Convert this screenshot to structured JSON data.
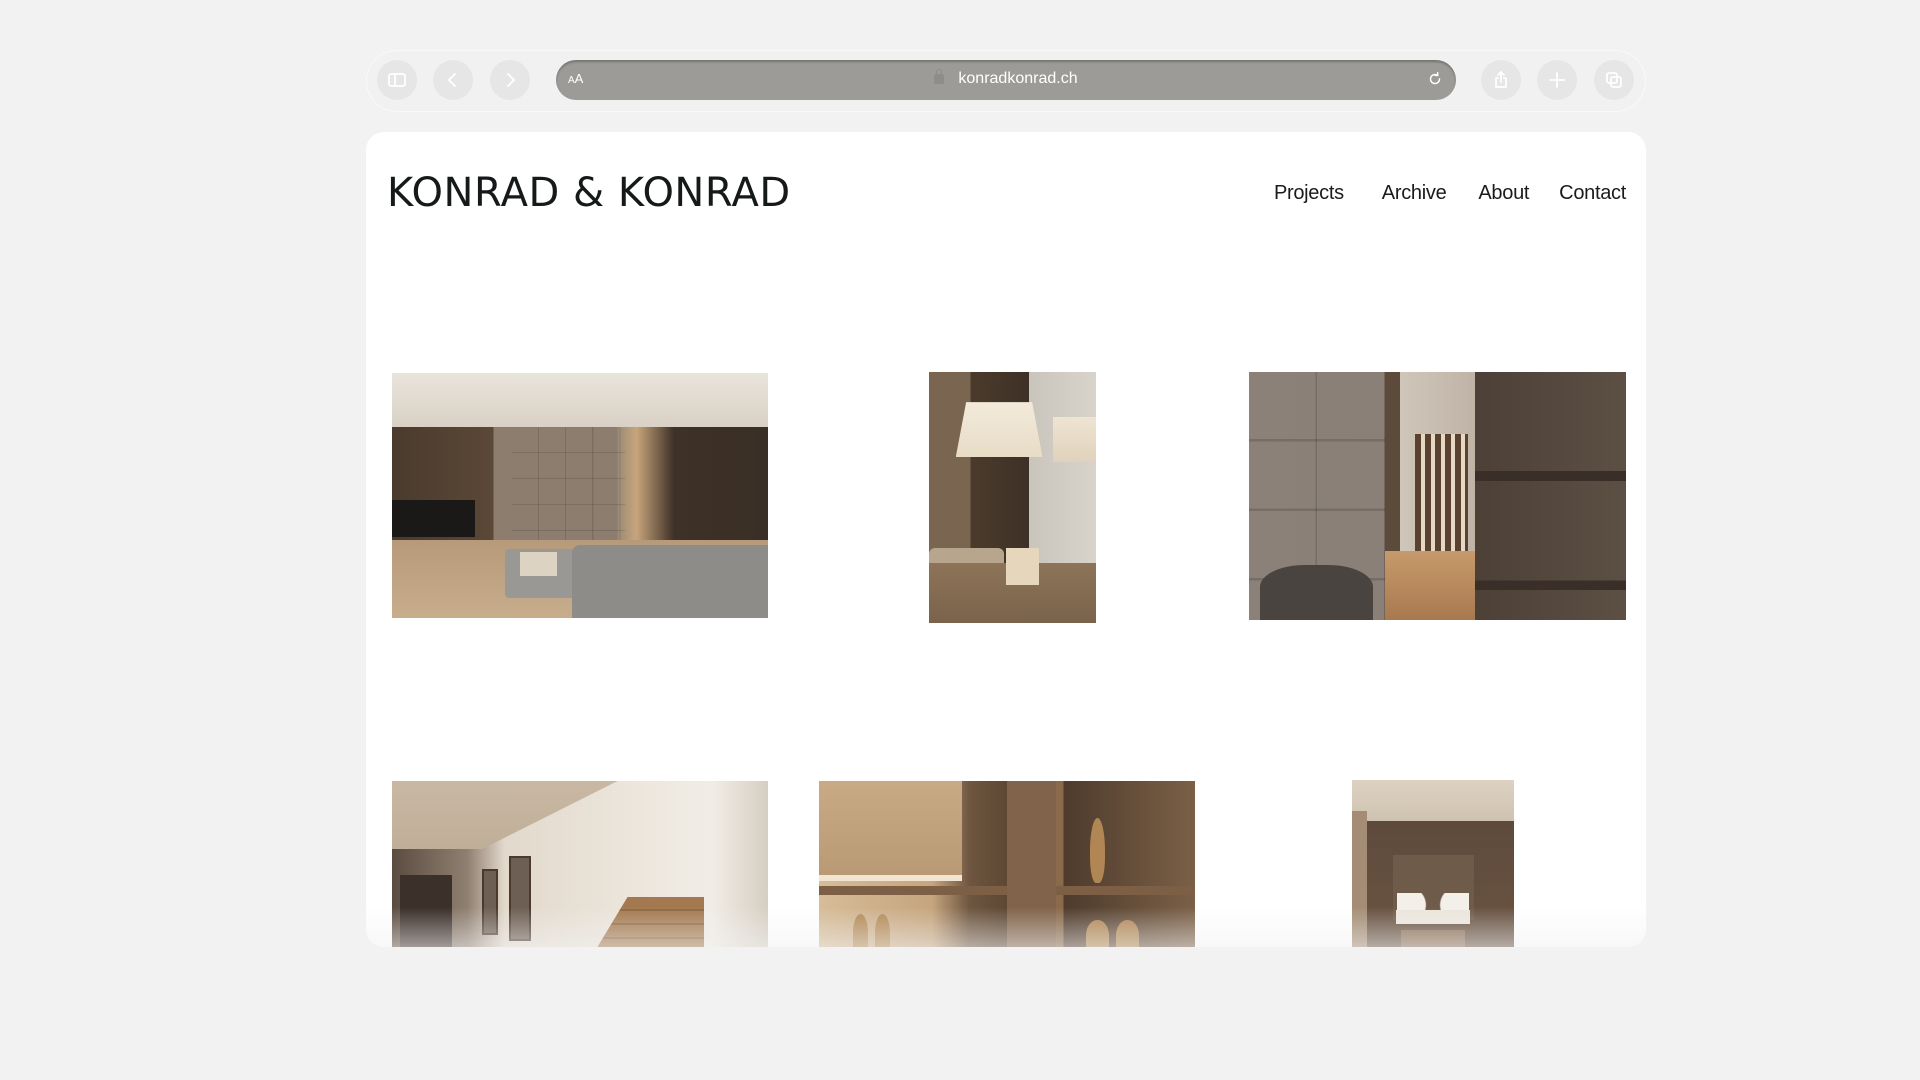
{
  "browser": {
    "url": "konradkonrad.ch",
    "reader_label": "AA",
    "buttons": {
      "sidebar": "sidebar-icon",
      "back": "chevron-left-icon",
      "forward": "chevron-right-icon",
      "reload": "reload-icon",
      "share": "share-icon",
      "new_tab": "plus-icon",
      "tabs": "tabs-overview-icon"
    }
  },
  "site": {
    "logo": "KONRAD & KONRAD",
    "nav": [
      {
        "label": "Projects"
      },
      {
        "label": "Archive"
      },
      {
        "label": "About"
      },
      {
        "label": "Contact"
      }
    ]
  },
  "gallery": {
    "rows": [
      {
        "images": [
          {
            "alt": "Living room with grey sectional sofa and wood-panelled fireplace wall"
          },
          {
            "alt": "Dining table under pendant lamps with wooden slat screen"
          },
          {
            "alt": "Hallway with wood cabinetry and slatted stair screen"
          }
        ]
      },
      {
        "images": [
          {
            "alt": "Entrance hall with wooden staircase and mirrors"
          },
          {
            "alt": "Wooden shelving with vases behind a lampshade"
          },
          {
            "alt": "Built-in window seat with cushions between shelves"
          }
        ]
      }
    ]
  }
}
